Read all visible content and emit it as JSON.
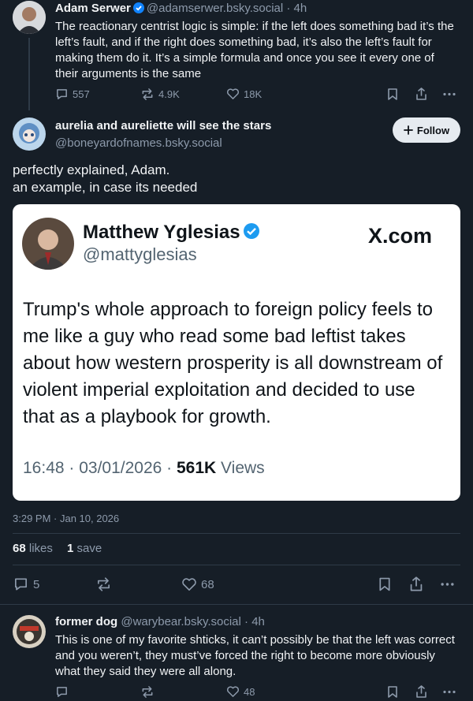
{
  "parent_post": {
    "author_name": "Adam Serwer",
    "handle": "@adamserwer.bsky.social",
    "time_sep": " · 4h",
    "text": "The reactionary centrist logic is simple: if the left does something bad it’s the left’s fault, and if the right does something bad, it’s also the left’s fault for making them do it. It’s a simple formula and once you see it every one of their arguments is the same",
    "replies": "557",
    "reposts": "4.9K",
    "likes": "18K"
  },
  "main_post": {
    "author_name": "aurelia and aureliette will see the stars",
    "handle": "@boneyardofnames.bsky.social",
    "follow_label": "Follow",
    "text_line1": "perfectly explained, Adam.",
    "text_line2": "an example, in case its needed",
    "embed": {
      "name": "Matthew Yglesias",
      "handle": "@mattyglesias",
      "site": "X.com",
      "text": "Trump's whole approach to foreign policy feels to me like a guy who read some bad leftist takes about how western prosperity is all downstream of violent imperial exploitation and decided to use that as a playbook for growth.",
      "time": "16:48 · 03/01/2026 · ",
      "views_count": "561K",
      "views_label": " Views"
    },
    "timestamp": "3:29 PM · Jan 10, 2026",
    "likes_count": "68",
    "likes_label": " likes",
    "saves_count": "1",
    "saves_label": " save",
    "replies": "5",
    "likes": "68"
  },
  "reply_post": {
    "author_name": "former dog",
    "handle": "@warybear.bsky.social",
    "time_sep": " · 4h",
    "text": "This is one of my favorite shticks, it can’t possibly be that the left was correct and you weren’t, they must’ve forced the right to become more obviously what they said they were all along.",
    "likes": "48"
  },
  "colors": {
    "background": "#161e27",
    "text": "#f1f3f5",
    "muted": "#8d9aab",
    "verified": "#1083fe"
  }
}
